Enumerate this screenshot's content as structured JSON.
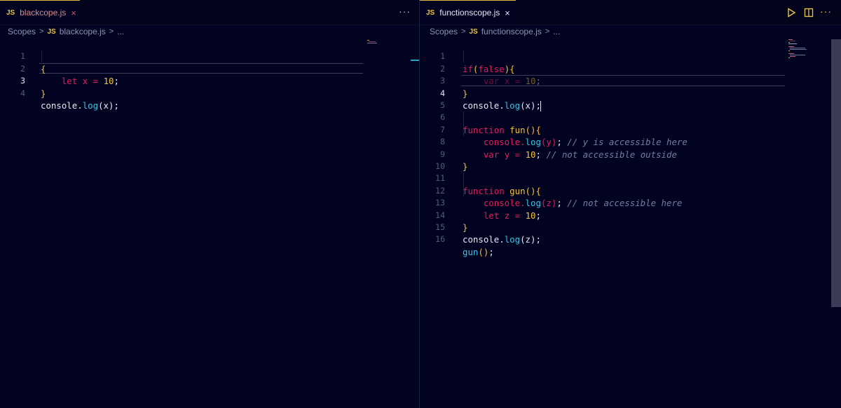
{
  "left_editor": {
    "tab": {
      "badge": "JS",
      "name": "blackcope.js",
      "close": "×"
    },
    "more": "···",
    "breadcrumb": {
      "folder": "Scopes",
      "sep": ">",
      "badge": "JS",
      "file": "blackcope.js",
      "sep2": ">",
      "tail": "..."
    },
    "lines": [
      {
        "num": "1"
      },
      {
        "num": "2"
      },
      {
        "num": "3"
      },
      {
        "num": "4"
      }
    ]
  },
  "right_editor": {
    "tab": {
      "badge": "JS",
      "name": "functionscope.js",
      "close": "×"
    },
    "more": "···",
    "breadcrumb": {
      "folder": "Scopes",
      "sep": ">",
      "badge": "JS",
      "file": "functionscope.js",
      "sep2": ">",
      "tail": "..."
    },
    "lines": [
      {
        "num": "1"
      },
      {
        "num": "2"
      },
      {
        "num": "3"
      },
      {
        "num": "4"
      },
      {
        "num": "5"
      },
      {
        "num": "6"
      },
      {
        "num": "7"
      },
      {
        "num": "8"
      },
      {
        "num": "9"
      },
      {
        "num": "10"
      },
      {
        "num": "11"
      },
      {
        "num": "12"
      },
      {
        "num": "13"
      },
      {
        "num": "14"
      },
      {
        "num": "15"
      },
      {
        "num": "16"
      }
    ],
    "comments": {
      "l7": "// y is accessible here",
      "l8": "// not accessible outside",
      "l12": "// not accessible here"
    }
  },
  "icons": [
    "play-icon",
    "split-editor-icon",
    "more-icon",
    "close-icon"
  ],
  "colors": {
    "background": "#020320",
    "accent_tab": "#e0b33c",
    "keyword": "#e21d5b",
    "brace": "#f5bd3a",
    "method": "#36c4e4",
    "number": "#f0c340",
    "comment": "#757ba3"
  }
}
